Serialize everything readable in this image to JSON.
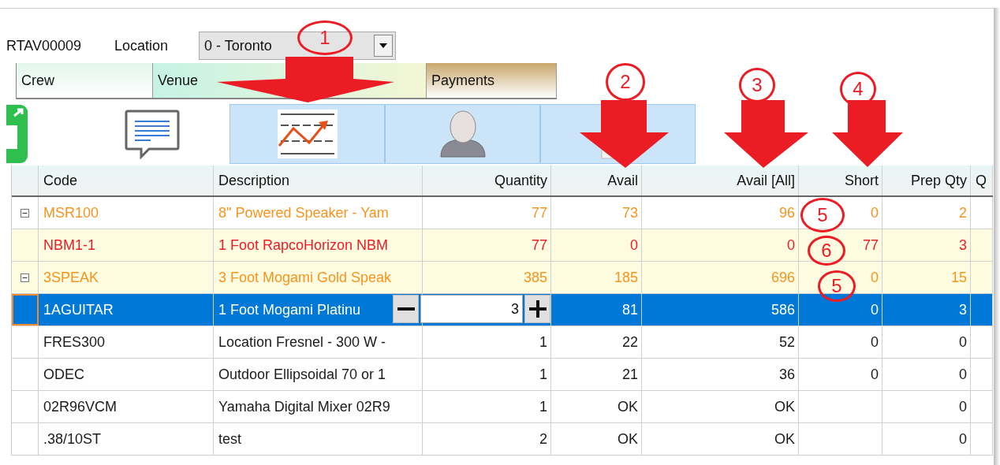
{
  "order_code": "RTAV00009",
  "location": {
    "label": "Location",
    "value": "0 - Toronto"
  },
  "tabs": [
    {
      "label": "Crew",
      "color": "#e2f6ec"
    },
    {
      "label": "Venue",
      "color": "#c6f3e6"
    },
    {
      "label": "Payments",
      "color": "#c8a76c"
    }
  ],
  "toolbar": [
    {
      "kind": "notes",
      "selected": false
    },
    {
      "kind": "chart",
      "selected": true
    },
    {
      "kind": "person",
      "selected": true
    },
    {
      "kind": "document",
      "selected": true
    }
  ],
  "table": {
    "columns": [
      {
        "label": "Code"
      },
      {
        "label": "Description"
      },
      {
        "label": "Quantity"
      },
      {
        "label": "Avail"
      },
      {
        "label": "Avail [All]"
      },
      {
        "label": "Short"
      },
      {
        "label": "Prep Qty"
      },
      {
        "label": "Q"
      }
    ],
    "rows": [
      {
        "kind": "group",
        "expanded": true,
        "selected": false,
        "highlight": false,
        "color": "#f7941d",
        "code": "MSR100",
        "description": "8\" Powered Speaker - Yam",
        "quantity": "77",
        "avail": "73",
        "avail_all": "96",
        "short": "0",
        "prep_qty": "2"
      },
      {
        "kind": "item",
        "selected": false,
        "highlight": true,
        "color": "#ee1c25",
        "code": "NBM1-1",
        "description": "1 Foot RapcoHorizon NBM",
        "quantity": "77",
        "avail": "0",
        "avail_all": "0",
        "short": "77",
        "prep_qty": "3"
      },
      {
        "kind": "group",
        "expanded": true,
        "selected": false,
        "highlight": true,
        "color": "#f7941d",
        "code": "3SPEAK",
        "description": "3 Foot Mogami Gold Speak",
        "quantity": "385",
        "avail": "185",
        "avail_all": "696",
        "short": "0",
        "prep_qty": "15"
      },
      {
        "kind": "item",
        "selected": true,
        "highlight": false,
        "color": "#ffffff",
        "code": "1AGUITAR",
        "description": "1 Foot Mogami Platinu",
        "quantity_editor": {
          "value": "3"
        },
        "avail": "81",
        "avail_all": "586",
        "short": "0",
        "prep_qty": "3"
      },
      {
        "kind": "item",
        "selected": false,
        "highlight": false,
        "color": "#1a1a1a",
        "code": "FRES300",
        "description": "Location Fresnel - 300 W -",
        "quantity": "1",
        "avail": "22",
        "avail_all": "52",
        "short": "0",
        "prep_qty": "0"
      },
      {
        "kind": "item",
        "selected": false,
        "highlight": false,
        "color": "#1a1a1a",
        "code": "ODEC",
        "description": "Outdoor Ellipsoidal 70 or 1",
        "quantity": "1",
        "avail": "21",
        "avail_all": "36",
        "short": "0",
        "prep_qty": "0"
      },
      {
        "kind": "item",
        "selected": false,
        "highlight": false,
        "color": "#1a1a1a",
        "code": "02R96VCM",
        "description": "Yamaha Digital Mixer 02R9",
        "quantity": "1",
        "avail": "OK",
        "avail_all": "OK",
        "prep_qty": "0"
      },
      {
        "kind": "item",
        "selected": false,
        "highlight": false,
        "color": "#1a1a1a",
        "code": ".38/10ST",
        "description": "test",
        "quantity": "2",
        "avail": "OK",
        "avail_all": "OK",
        "prep_qty": "0"
      }
    ]
  },
  "annotations": [
    {
      "label": "1",
      "arrow": true
    },
    {
      "label": "2",
      "arrow": true
    },
    {
      "label": "3",
      "arrow": true
    },
    {
      "label": "4",
      "arrow": true
    },
    {
      "label": "5",
      "arrow": false
    },
    {
      "label": "6",
      "arrow": false
    },
    {
      "label": "5",
      "arrow": false
    }
  ]
}
